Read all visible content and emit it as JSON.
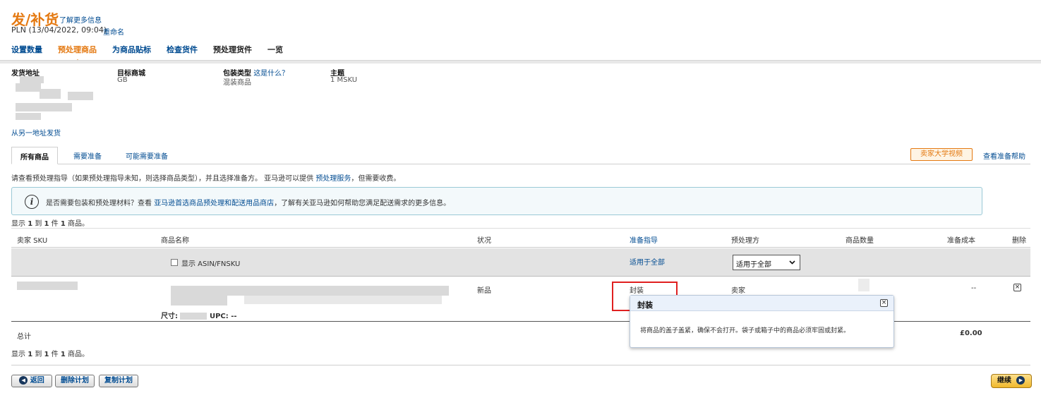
{
  "header": {
    "title": "发/补货",
    "learn_more": "了解更多信息",
    "plan_name": "PLN (13/04/2022, 09:04)",
    "rename": "重命名"
  },
  "workflow": [
    {
      "label": "设置数量",
      "state": "link"
    },
    {
      "label": "预处理商品",
      "state": "active"
    },
    {
      "label": "为商品贴标",
      "state": "link"
    },
    {
      "label": "检查货件",
      "state": "link"
    },
    {
      "label": "预处理货件",
      "state": "plain"
    },
    {
      "label": "一览",
      "state": "plain"
    }
  ],
  "info": {
    "ship_from_label": "发货地址",
    "destination_label": "目标商城",
    "destination_value": "GB",
    "packing_label": "包装类型",
    "packing_help": "这是什么？",
    "packing_value": "混装商品",
    "subject_label": "主题",
    "subject_value": "1 MSKU",
    "ship_other": "从另一地址发货"
  },
  "tabs": [
    "所有商品",
    "需要准备",
    "可能需要准备"
  ],
  "video_button": "卖家大学视频",
  "help_link": "查看准备帮助",
  "instruction": {
    "before": "请查看预处理指导（如果预处理指导未知，则选择商品类型），并且选择准备方。 亚马逊可以提供 ",
    "link": "预处理服务",
    "after": "，但需要收费。"
  },
  "alert": {
    "icon": "info-icon",
    "before": "是否需要包装和预处理材料？查看 ",
    "link": "亚马逊首选商品预处理和配送用品商店",
    "after": "，了解有关亚马逊如何帮助您满足配送需求的更多信息。"
  },
  "showing": {
    "prefix": "显示 ",
    "from": "1",
    "mid1": " 到 ",
    "to": "1",
    "mid2": " 件 ",
    "total": "1",
    "suffix": " 商品。"
  },
  "table": {
    "headers": {
      "sku": "卖家 SKU",
      "name": "商品名称",
      "condition": "状况",
      "prep_guide": "准备指导",
      "prep_by": "预处理方",
      "quantity": "商品数量",
      "prep_cost": "准备成本",
      "delete": "删除"
    },
    "filter": {
      "show_asin": "显示 ASIN/FNSKU",
      "apply_all_link": "适用于全部",
      "apply_all_select": "适用于全部"
    },
    "row": {
      "condition": "新品",
      "prep_guide": "封装",
      "prep_by": "卖家",
      "prep_cost": "--",
      "detail_prefix": "尺寸:",
      "upc": "UPC: --"
    },
    "total_label": "总计",
    "total_value": "£0.00"
  },
  "popover": {
    "title": "封装",
    "body": "将商品的盖子盖紧，确保不会打开。袋子或箱子中的商品必须牢固或封紧。"
  },
  "buttons": {
    "back": "返回",
    "delete_plan": "删除计划",
    "copy_plan": "复制计划",
    "continue": "继续"
  },
  "colors": {
    "accent": "#e47911",
    "link": "#004b91",
    "highlight": "#e02020"
  }
}
